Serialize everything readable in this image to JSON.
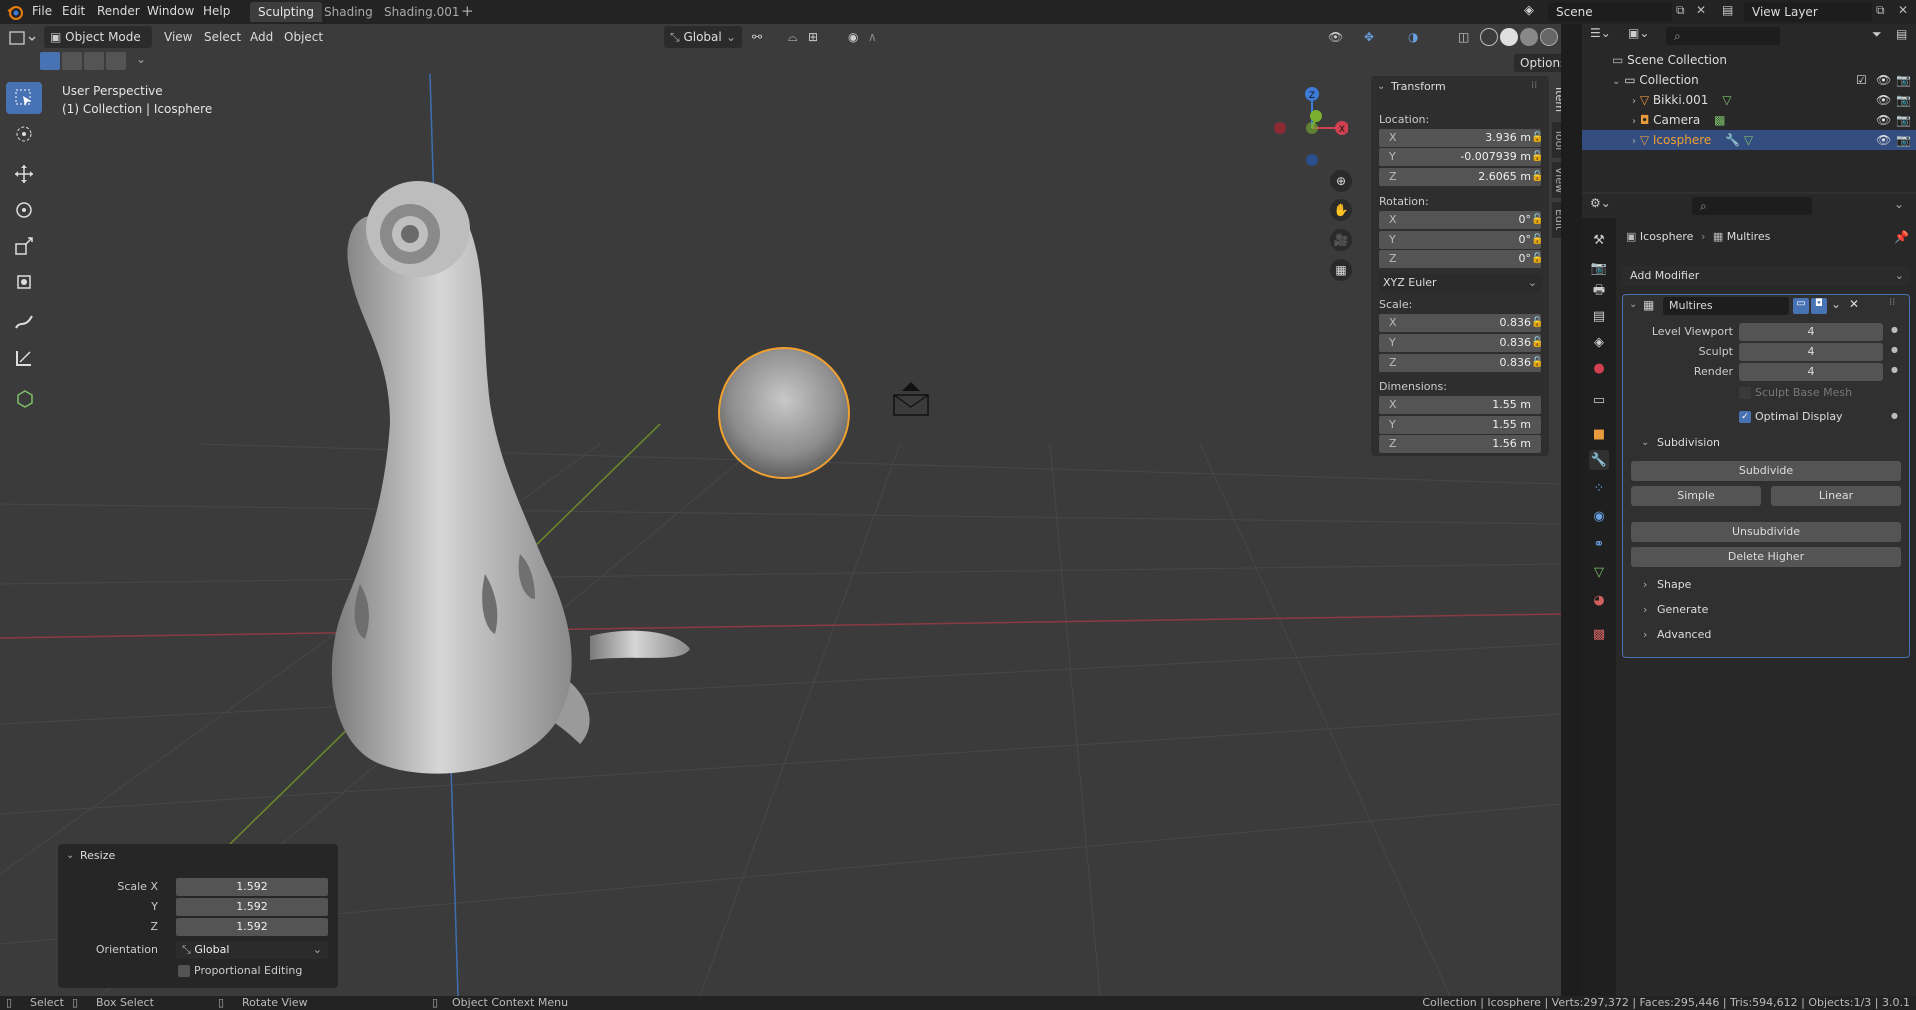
{
  "menu": {
    "file": "File",
    "edit": "Edit",
    "render": "Render",
    "window": "Window",
    "help": "Help"
  },
  "workspaces": [
    "Sculpting",
    "Shading",
    "Shading.001"
  ],
  "scene": "Scene",
  "view_layer": "View Layer",
  "header": {
    "mode": "Object Mode",
    "view": "View",
    "select": "Select",
    "add": "Add",
    "object": "Object",
    "orientation": "Global",
    "options": "Options"
  },
  "viewport": {
    "perspective": "User Perspective",
    "collection_info": "(1) Collection | Icosphere"
  },
  "gizmo": {
    "z": "Z",
    "x": "X"
  },
  "transform": {
    "title": "Transform",
    "location_label": "Location:",
    "location": {
      "x": "3.936 m",
      "y": "-0.007939 m",
      "z": "2.6065 m"
    },
    "rotation_label": "Rotation:",
    "rotation": {
      "x": "0°",
      "y": "0°",
      "z": "0°"
    },
    "rotation_mode": "XYZ Euler",
    "scale_label": "Scale:",
    "scale": {
      "x": "0.836",
      "y": "0.836",
      "z": "0.836"
    },
    "dimensions_label": "Dimensions:",
    "dimensions": {
      "x": "1.55 m",
      "y": "1.55 m",
      "z": "1.56 m"
    },
    "axes": {
      "x": "X",
      "y": "Y",
      "z": "Z"
    }
  },
  "side_tabs": [
    "Item",
    "Tool",
    "View",
    "Edit"
  ],
  "outliner": {
    "scene_collection": "Scene Collection",
    "collection": "Collection",
    "items": [
      "Bikki.001",
      "Camera",
      "Icosphere"
    ]
  },
  "properties": {
    "breadcrumb_object": "Icosphere",
    "breadcrumb_modifier": "Multires",
    "add_modifier": "Add Modifier",
    "modifier_name": "Multires",
    "level_viewport_label": "Level Viewport",
    "level_viewport": "4",
    "sculpt_label": "Sculpt",
    "sculpt": "4",
    "render_label": "Render",
    "render": "4",
    "sculpt_base_mesh": "Sculpt Base Mesh",
    "optimal_display": "Optimal Display",
    "subdivision": "Subdivision",
    "subdivide": "Subdivide",
    "simple": "Simple",
    "linear": "Linear",
    "unsubdivide": "Unsubdivide",
    "delete_higher": "Delete Higher",
    "shape": "Shape",
    "generate": "Generate",
    "advanced": "Advanced"
  },
  "resize_panel": {
    "title": "Resize",
    "scale_x_label": "Scale X",
    "y_label": "Y",
    "z_label": "Z",
    "scale_x": "1.592",
    "scale_y": "1.592",
    "scale_z": "1.592",
    "orientation_label": "Orientation",
    "orientation": "Global",
    "proportional": "Proportional Editing"
  },
  "status": {
    "select": "Select",
    "box_select": "Box Select",
    "rotate_view": "Rotate View",
    "context_menu": "Object Context Menu",
    "stats": "Collection | Icosphere | Verts:297,372 | Faces:295,446 | Tris:594,612 | Objects:1/3 | 3.0.1"
  },
  "colors": {
    "accent": "#4772b3",
    "selected_outline": "#f0a030",
    "x_axis": "#d04050",
    "y_axis": "#7ab030",
    "z_axis": "#3d7bd9"
  }
}
